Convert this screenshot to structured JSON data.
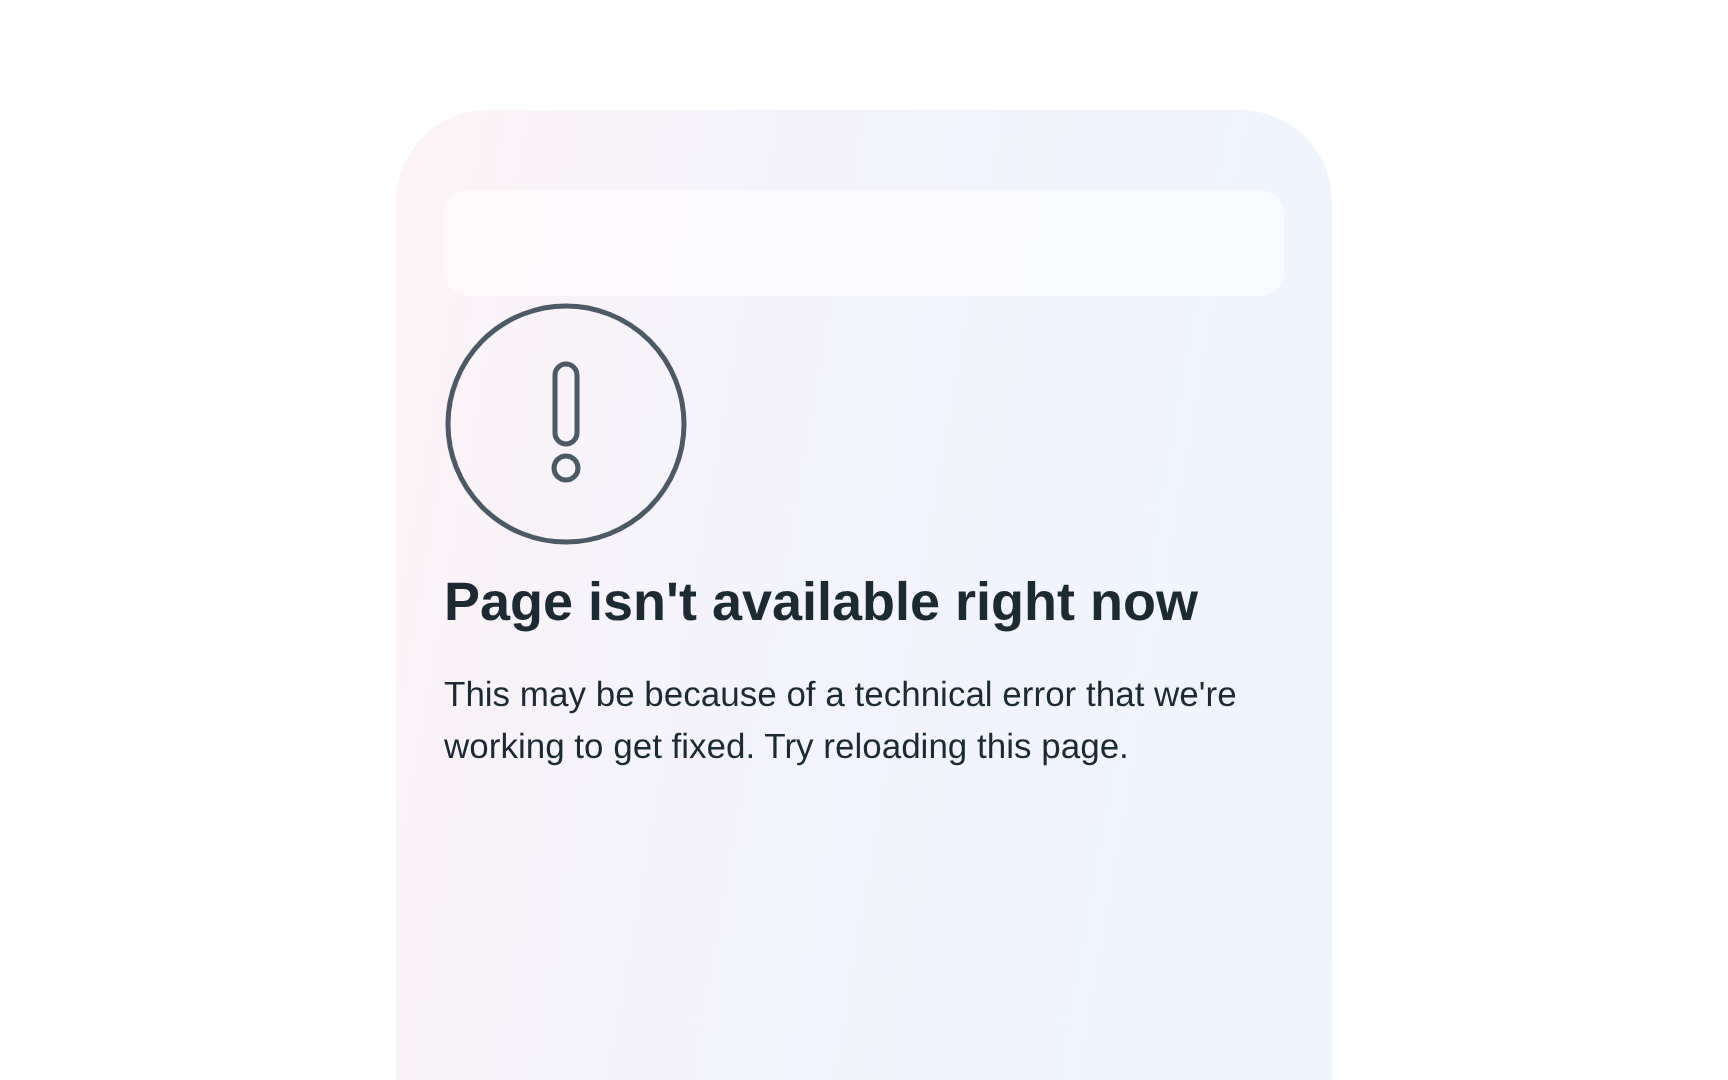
{
  "error": {
    "title": "Page isn't available right now",
    "message": "This may be because of a technical error that we're working to get fixed. Try reloading this page."
  }
}
